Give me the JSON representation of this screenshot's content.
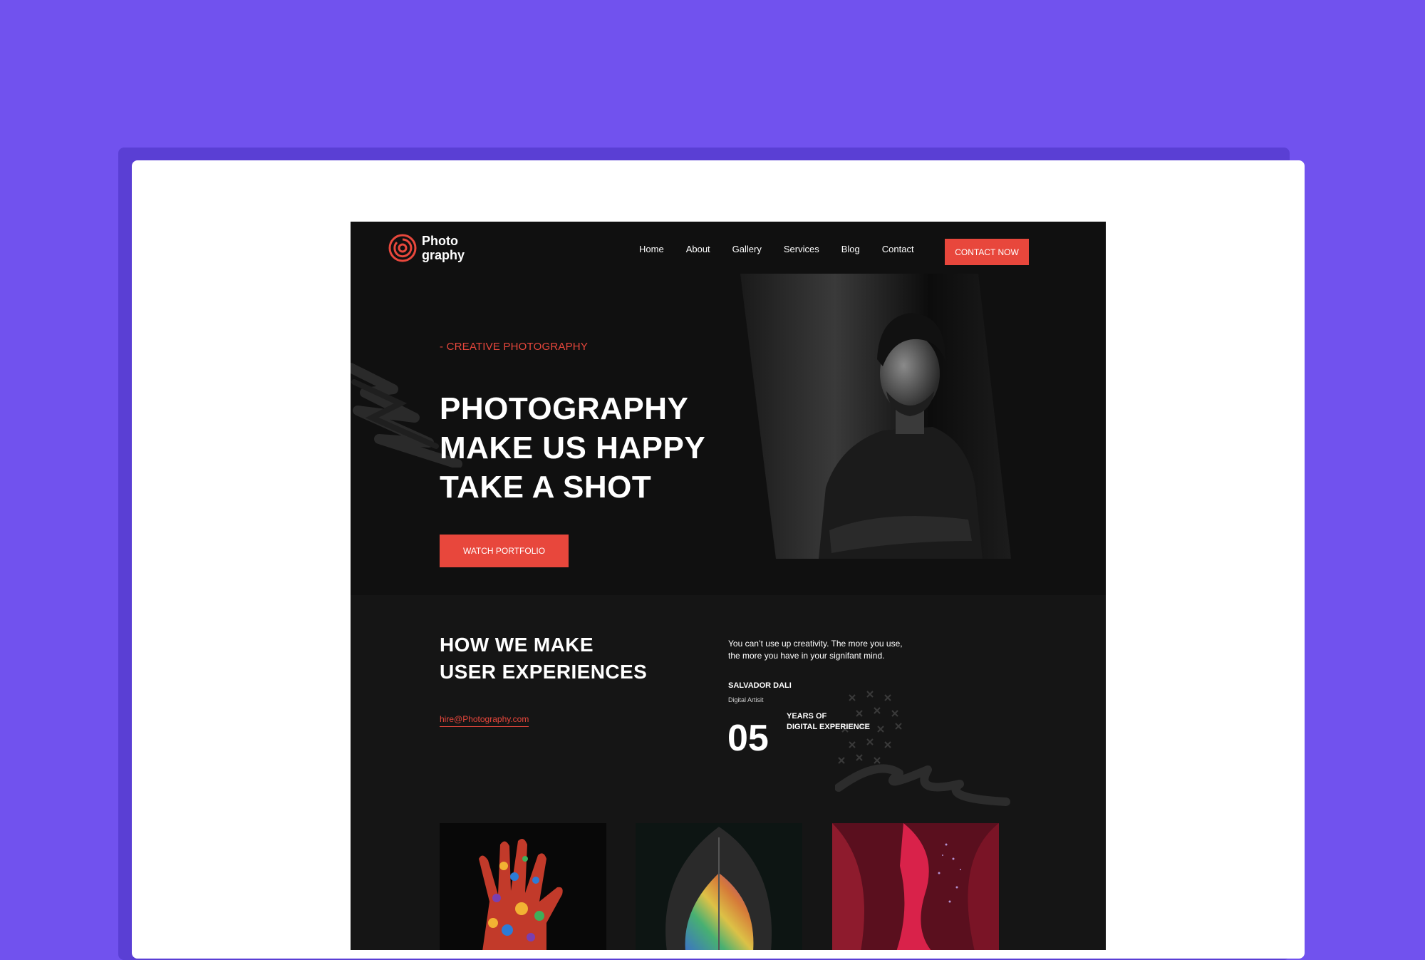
{
  "brand": {
    "name_line1": "Photo",
    "name_line2": "graphy",
    "accent": "#e8473c",
    "background": "#7152ee"
  },
  "nav": {
    "items": [
      {
        "label": "Home"
      },
      {
        "label": "About"
      },
      {
        "label": "Gallery"
      },
      {
        "label": "Services"
      },
      {
        "label": "Blog"
      },
      {
        "label": "Contact"
      }
    ],
    "cta_label": "CONTACT NOW"
  },
  "hero": {
    "kicker": "- CREATIVE PHOTOGRAPHY",
    "headline_line1": "PHOTOGRAPHY",
    "headline_line2": "MAKE US HAPPY",
    "headline_line3": "TAKE A SHOT",
    "button_label": "WATCH PORTFOLIO"
  },
  "about": {
    "heading_line1": "HOW WE MAKE",
    "heading_line2": "USER EXPERIENCES",
    "email": "hire@Photography.com",
    "quote_line1": "You can’t use up creativity. The more you use,",
    "quote_line2": "the more you have in your signifant mind.",
    "author": "SALVADOR DALI",
    "author_role": "Digital Artisit",
    "years_value": "05",
    "years_label_line1": "YEARS OF",
    "years_label_line2": "DIGITAL EXPERIENCE"
  },
  "gallery": {
    "items": [
      {
        "icon": "painted-hand-photo"
      },
      {
        "icon": "rainbow-leaf-photo"
      },
      {
        "icon": "red-canyon-photo"
      }
    ]
  }
}
